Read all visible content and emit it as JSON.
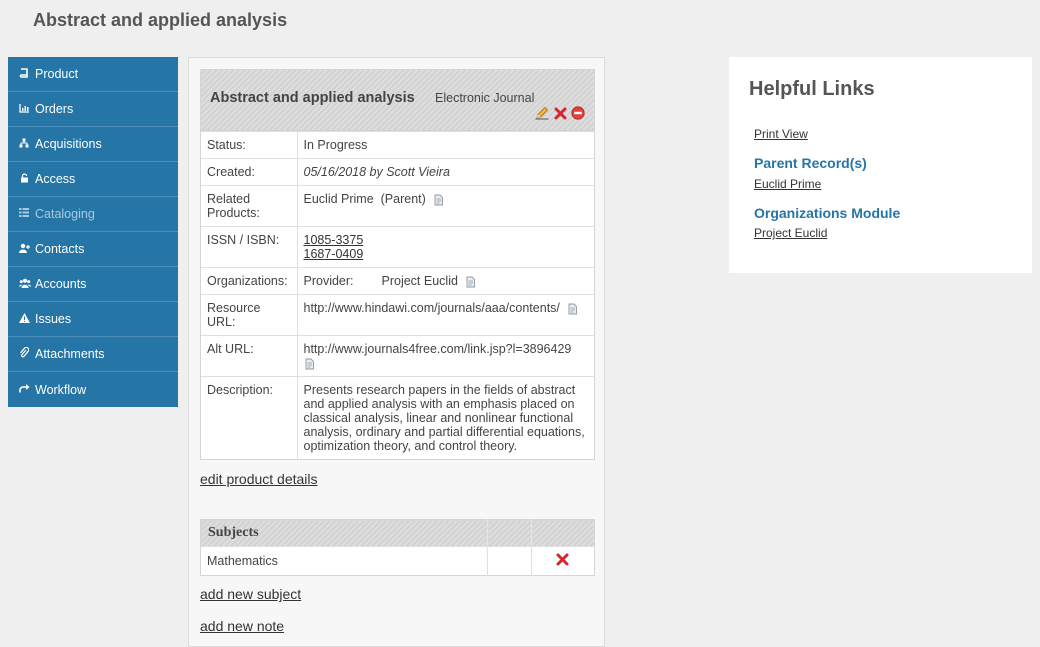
{
  "page": {
    "title": "Abstract and applied analysis"
  },
  "sidebar": {
    "items": [
      {
        "label": "Product",
        "icon": "book-icon"
      },
      {
        "label": "Orders",
        "icon": "bar-chart-icon"
      },
      {
        "label": "Acquisitions",
        "icon": "sitemap-icon"
      },
      {
        "label": "Access",
        "icon": "unlock-icon"
      },
      {
        "label": "Cataloging",
        "icon": "list-icon",
        "disabled": true
      },
      {
        "label": "Contacts",
        "icon": "user-plus-icon"
      },
      {
        "label": "Accounts",
        "icon": "users-icon"
      },
      {
        "label": "Issues",
        "icon": "warning-icon"
      },
      {
        "label": "Attachments",
        "icon": "paperclip-icon"
      },
      {
        "label": "Workflow",
        "icon": "share-icon"
      }
    ]
  },
  "product": {
    "title": "Abstract and applied analysis",
    "type": "Electronic Journal",
    "fields": {
      "status": {
        "label": "Status:",
        "value": "In Progress"
      },
      "created": {
        "label": "Created:",
        "value": "05/16/2018 by Scott Vieira"
      },
      "related": {
        "label_line1": "Related",
        "label_line2": "Products:",
        "value": "Euclid Prime",
        "suffix": "(Parent)"
      },
      "issn": {
        "label": "ISSN / ISBN:",
        "values": [
          "1085-3375",
          "1687-0409"
        ]
      },
      "organizations": {
        "label": "Organizations:",
        "role": "Provider:",
        "value": "Project Euclid"
      },
      "resource_url": {
        "label_line1": "Resource",
        "label_line2": "URL:",
        "value": "http://www.hindawi.com/journals/aaa/contents/"
      },
      "alt_url": {
        "label": "Alt URL:",
        "value": "http://www.journals4free.com/link.jsp?l=3896429"
      },
      "description": {
        "label": "Description:",
        "value": "Presents research papers in the fields of abstract and applied analysis with an emphasis placed on classical analysis, linear and nonlinear functional analysis, ordinary and partial differential equations, optimization theory, and control theory."
      }
    },
    "edit_link": "edit product details"
  },
  "subjects": {
    "header": "Subjects",
    "rows": [
      {
        "name": "Mathematics"
      }
    ],
    "add_link": "add new subject"
  },
  "notes": {
    "add_link": "add new note"
  },
  "helpful_links": {
    "title": "Helpful Links",
    "print_view": "Print View",
    "parent_heading": "Parent Record(s)",
    "parent_link": "Euclid Prime",
    "org_heading": "Organizations Module",
    "org_link": "Project Euclid"
  },
  "colors": {
    "sidebar": "#2575a6",
    "accent": "#2575a6",
    "delete": "#d9232e"
  }
}
